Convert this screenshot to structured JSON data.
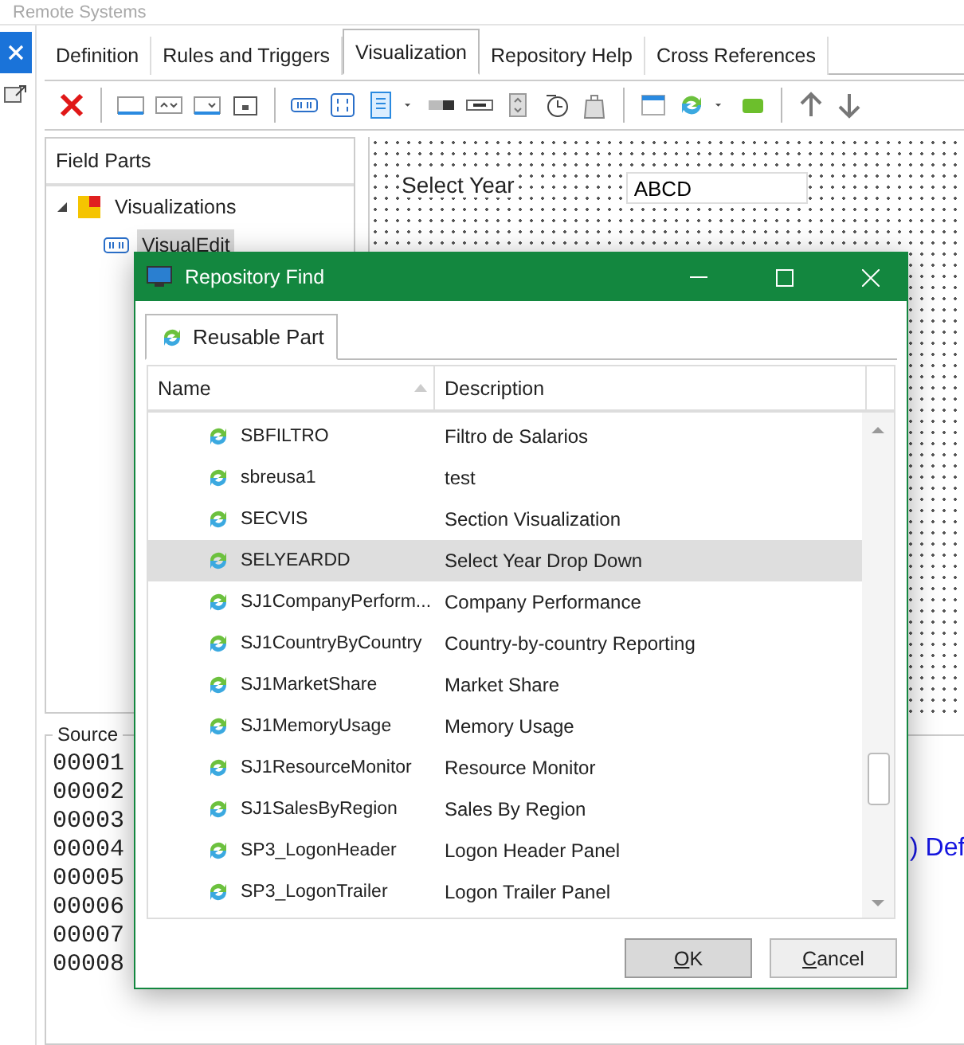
{
  "top_label": "Remote Systems",
  "tabs": [
    {
      "label": "Definition",
      "selected": false
    },
    {
      "label": "Rules and Triggers",
      "selected": false
    },
    {
      "label": "Visualization",
      "selected": true
    },
    {
      "label": "Repository Help",
      "selected": false
    },
    {
      "label": "Cross References",
      "selected": false
    }
  ],
  "field_parts": {
    "title": "Field Parts",
    "tree": [
      {
        "label": "Visualizations",
        "expanded": true,
        "children": [
          {
            "label": "VisualEdit",
            "selected": true
          }
        ]
      }
    ]
  },
  "canvas": {
    "label": "Select Year",
    "field_value": "ABCD"
  },
  "source": {
    "title": "Source",
    "lines": [
      {
        "number": "00001"
      },
      {
        "number": "00002"
      },
      {
        "number": "00003"
      },
      {
        "number": "00004",
        "code": ") Def"
      },
      {
        "number": "00005"
      },
      {
        "number": "00006"
      },
      {
        "number": "00007"
      },
      {
        "number": "00008"
      }
    ]
  },
  "dialog": {
    "title": "Repository Find",
    "tabs": [
      {
        "label": "Reusable Part",
        "selected": true
      }
    ],
    "columns": [
      "Name",
      "Description"
    ],
    "rows": [
      {
        "name": "SBFILTRO",
        "description": "Filtro de Salarios",
        "selected": false
      },
      {
        "name": "sbreusa1",
        "description": "test",
        "selected": false
      },
      {
        "name": "SECVIS",
        "description": "Section Visualization",
        "selected": false
      },
      {
        "name": "SELYEARDD",
        "description": "Select Year Drop Down",
        "selected": true
      },
      {
        "name": "SJ1CompanyPerform...",
        "description": "Company Performance",
        "selected": false
      },
      {
        "name": "SJ1CountryByCountry",
        "description": "Country-by-country Reporting",
        "selected": false
      },
      {
        "name": "SJ1MarketShare",
        "description": "Market Share",
        "selected": false
      },
      {
        "name": "SJ1MemoryUsage",
        "description": "Memory Usage",
        "selected": false
      },
      {
        "name": "SJ1ResourceMonitor",
        "description": "Resource Monitor",
        "selected": false
      },
      {
        "name": "SJ1SalesByRegion",
        "description": "Sales By Region",
        "selected": false
      },
      {
        "name": "SP3_LogonHeader",
        "description": "Logon Header Panel",
        "selected": false
      },
      {
        "name": "SP3_LogonTrailer",
        "description": "Logon Trailer Panel",
        "selected": false
      }
    ],
    "buttons": [
      {
        "label": "OK",
        "default": true
      },
      {
        "label": "Cancel",
        "default": false
      }
    ]
  }
}
